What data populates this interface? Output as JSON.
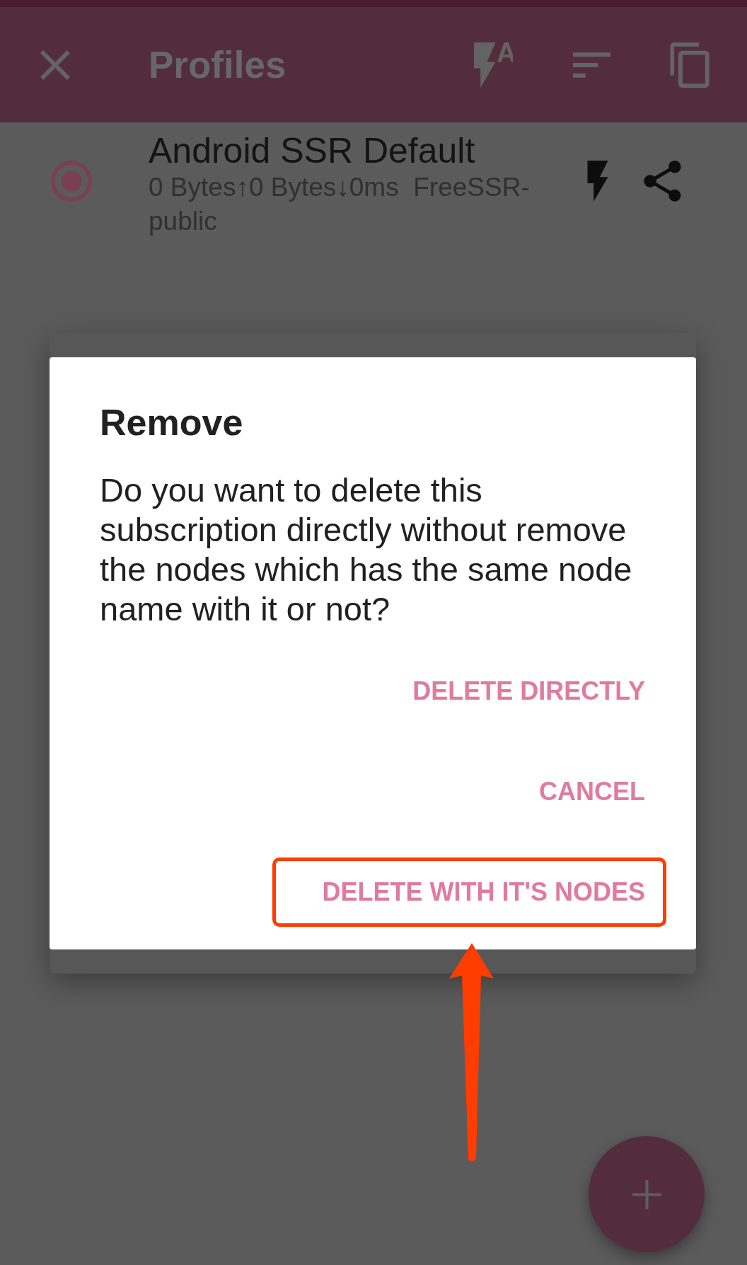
{
  "toolbar": {
    "title": "Profiles"
  },
  "profiles": [
    {
      "name": "Android SSR Default",
      "summary": "0 Bytes↑0 Bytes↓0ms  FreeSSR-public",
      "selected": true
    }
  ],
  "dialog": {
    "title": "Remove",
    "message": "Do you want to delete this subscription directly without remove the nodes which has the same node name with it or not?",
    "buttons": [
      {
        "label": "DELETE DIRECTLY",
        "highlighted": false
      },
      {
        "label": "CANCEL",
        "highlighted": false
      },
      {
        "label": "DELETE WITH IT'S NODES",
        "highlighted": true
      }
    ]
  }
}
